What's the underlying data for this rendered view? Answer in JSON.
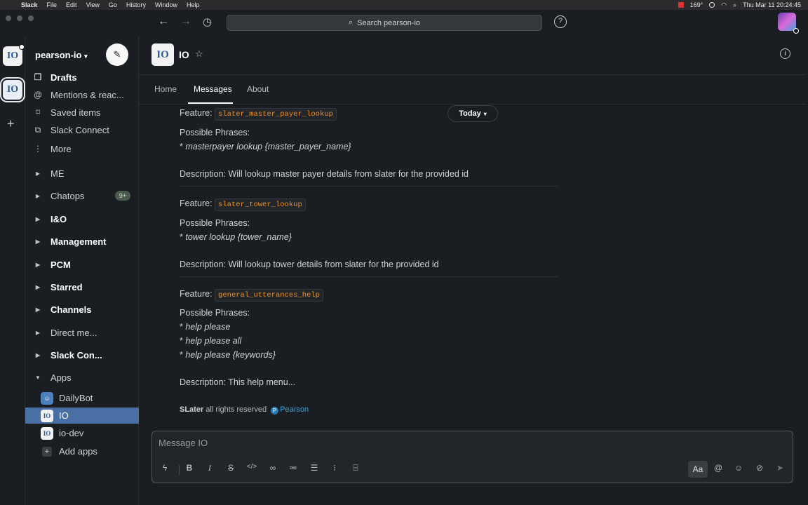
{
  "menubar": {
    "app": "Slack",
    "items": [
      "File",
      "Edit",
      "View",
      "Go",
      "History",
      "Window",
      "Help"
    ],
    "temperature": "169°",
    "datetime": "Thu Mar 11  20:24:45"
  },
  "topbar": {
    "search_placeholder": "Search pearson-io",
    "help_label": "?"
  },
  "workspace": {
    "name": "pearson-io",
    "logo_text": "IO"
  },
  "sidebar": {
    "nav": [
      {
        "label": "Drafts",
        "icon": "drafts-icon"
      },
      {
        "label": "Mentions & reac...",
        "icon": "at-icon"
      },
      {
        "label": "Saved items",
        "icon": "bookmark-icon"
      },
      {
        "label": "Slack Connect",
        "icon": "slack-connect-icon"
      },
      {
        "label": "More",
        "icon": "more-vertical-icon"
      }
    ],
    "sections": [
      {
        "label": "ME",
        "bold": false
      },
      {
        "label": "Chatops",
        "bold": false,
        "badge": "9+"
      },
      {
        "label": "I&O",
        "bold": true
      },
      {
        "label": "Management",
        "bold": true
      },
      {
        "label": "PCM",
        "bold": true
      },
      {
        "label": "Starred",
        "bold": true
      },
      {
        "label": "Channels",
        "bold": true
      },
      {
        "label": "Direct me...",
        "bold": false
      },
      {
        "label": "Slack Con...",
        "bold": true
      },
      {
        "label": "Apps",
        "bold": false
      }
    ],
    "apps": [
      {
        "label": "DailyBot"
      },
      {
        "label": "IO"
      },
      {
        "label": "io-dev"
      }
    ],
    "add_apps": "Add apps"
  },
  "channel": {
    "name": "IO",
    "tabs": [
      "Home",
      "Messages",
      "About"
    ],
    "active_tab": "Messages"
  },
  "messages": {
    "date_pill": "Today",
    "blocks": [
      {
        "feature_label": "Feature:",
        "feature": "slater_master_payer_lookup",
        "phrases_label": "Possible Phrases:",
        "phrases": [
          "masterpayer lookup {master_payer_name}"
        ],
        "description": "Description: Will lookup master payer details from slater for the provided id"
      },
      {
        "feature_label": "Feature:",
        "feature": "slater_tower_lookup",
        "phrases_label": "Possible Phrases:",
        "phrases": [
          "tower lookup {tower_name}"
        ],
        "description": "Description: Will lookup tower details from slater for the provided id"
      },
      {
        "feature_label": "Feature:",
        "feature": "general_utterances_help",
        "phrases_label": "Possible Phrases:",
        "phrases": [
          "help please",
          "help please all",
          "help please {keywords}"
        ],
        "description": "Description: This help menu..."
      }
    ],
    "bullet": "* ",
    "footer_brand": "SLater",
    "footer_text": " all rights reserved ",
    "footer_link": "Pearson"
  },
  "composer": {
    "placeholder": "Message IO",
    "aa_label": "Aa"
  },
  "colors": {
    "background": "#1a1d21",
    "selected": "#4a6fa5",
    "code": "#e8912d",
    "link": "#3ba5e0"
  }
}
